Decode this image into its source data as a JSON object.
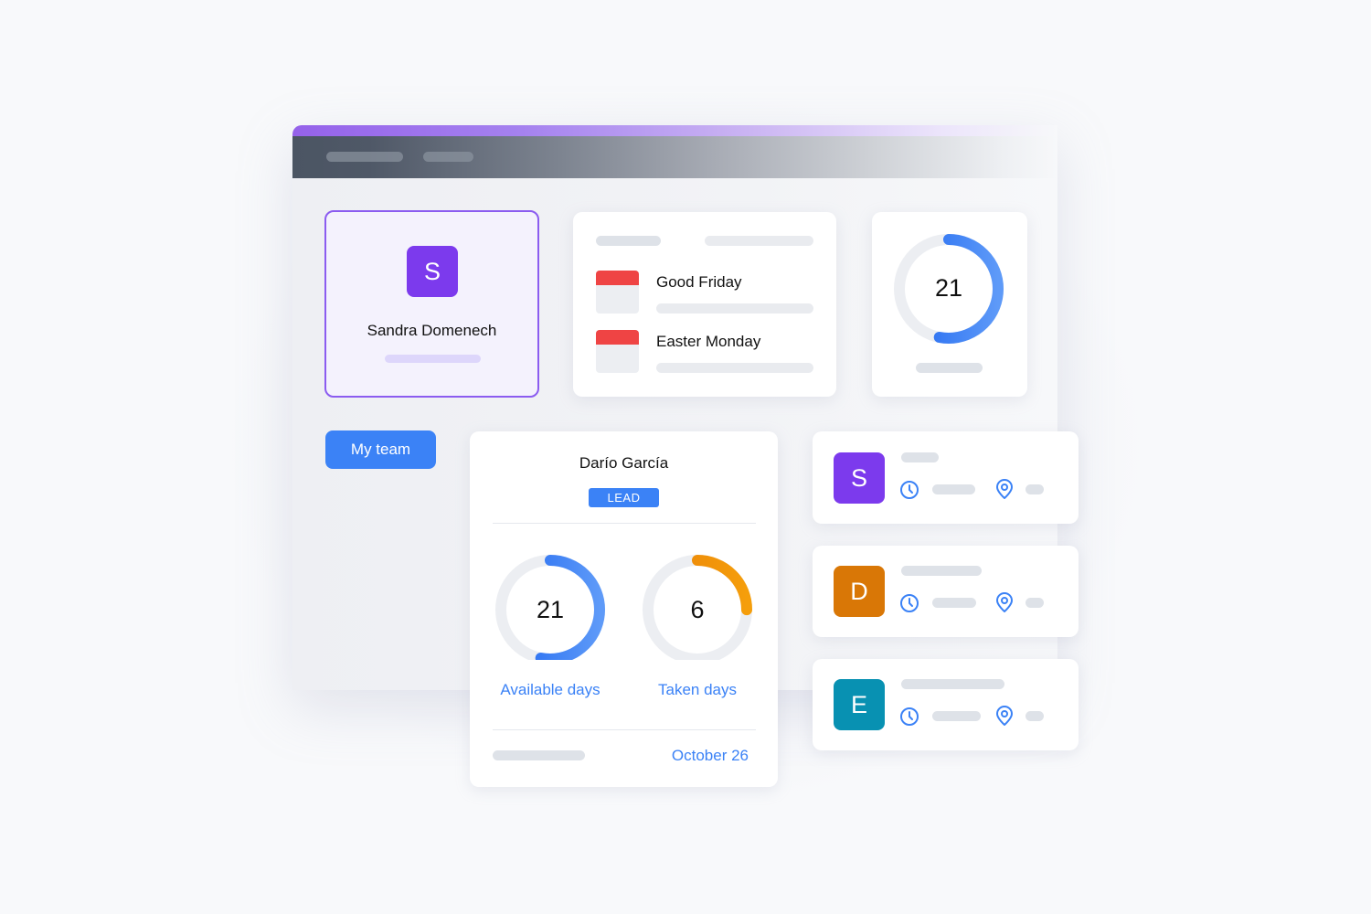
{
  "window": {
    "accent_color": "#9562ea",
    "bar_color": "#4b5563"
  },
  "profile": {
    "initial": "S",
    "name": "Sandra Domenech",
    "avatar_color": "#7c3aed"
  },
  "holidays": {
    "items": [
      {
        "name": "Good Friday",
        "icon": "calendar-icon"
      },
      {
        "name": "Easter Monday",
        "icon": "calendar-icon"
      }
    ]
  },
  "summary_ring": {
    "value": "21",
    "fraction": 0.53,
    "color": "#2f6ff3"
  },
  "team_button": {
    "label": "My team"
  },
  "employee_card": {
    "name": "Darío García",
    "badge": "LEAD",
    "stats": [
      {
        "value": "21",
        "label": "Available days",
        "fraction": 0.53,
        "color": "#2f6ff3"
      },
      {
        "value": "6",
        "label": "Taken days",
        "fraction": 0.25,
        "color": "#f08c0a"
      }
    ],
    "date": "October 26"
  },
  "team_members": [
    {
      "initial": "S",
      "color": "#7c3aed",
      "icons": [
        "clock-icon",
        "location-pin-icon"
      ]
    },
    {
      "initial": "D",
      "color": "#d97706",
      "icons": [
        "clock-icon",
        "location-pin-icon"
      ]
    },
    {
      "initial": "E",
      "color": "#0891b2",
      "icons": [
        "clock-icon",
        "location-pin-icon"
      ]
    }
  ],
  "accent_blue": "#3b82f6"
}
